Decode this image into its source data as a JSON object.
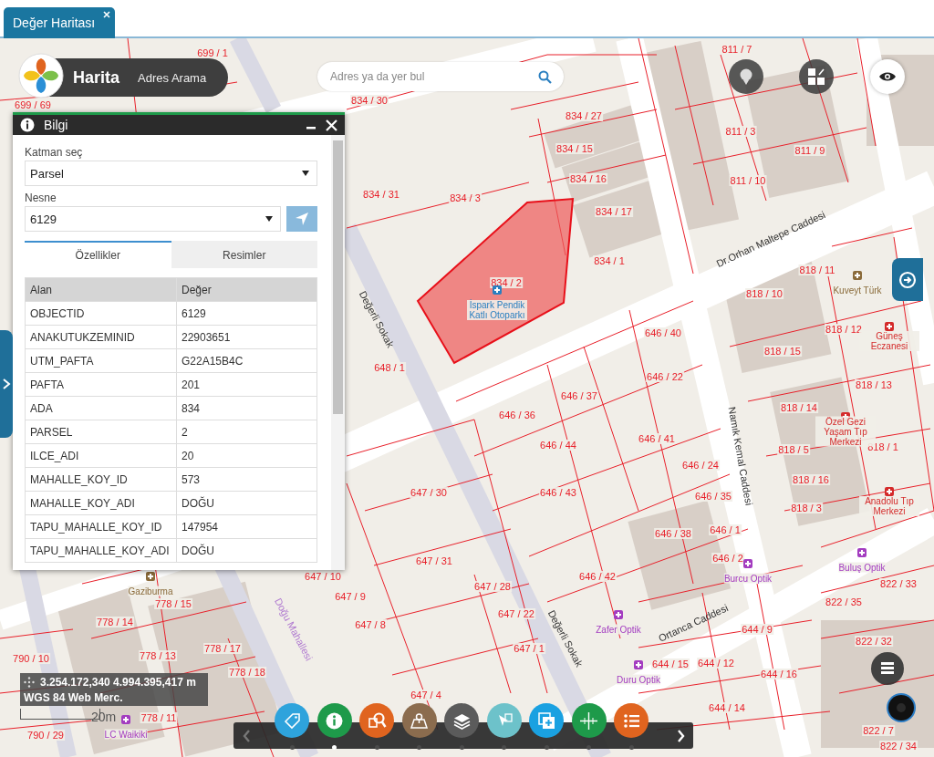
{
  "tabs": [
    {
      "label": "Değer Haritası",
      "selected": true
    }
  ],
  "app_bar": {
    "title": "Harita",
    "link": "Adres Arama"
  },
  "search": {
    "placeholder": "Adres ya da yer bul"
  },
  "info_panel": {
    "title": "Bilgi",
    "layer_label": "Katman seç",
    "layer_value": "Parsel",
    "object_label": "Nesne",
    "object_value": "6129",
    "tabs": [
      {
        "label": "Özellikler",
        "selected": true
      },
      {
        "label": "Resimler",
        "selected": false
      }
    ],
    "columns": [
      "Alan",
      "Değer"
    ],
    "rows": [
      [
        "OBJECTID",
        "6129"
      ],
      [
        "ANAKUTUKZEMINID",
        "22903651"
      ],
      [
        "UTM_PAFTA",
        "G22A15B4C"
      ],
      [
        "PAFTA",
        "201"
      ],
      [
        "ADA",
        "834"
      ],
      [
        "PARSEL",
        "2"
      ],
      [
        "ILCE_ADI",
        "20"
      ],
      [
        "MAHALLE_KOY_ID",
        "573"
      ],
      [
        "MAHALLE_KOY_ADI",
        "DOĞU"
      ],
      [
        "TAPU_MAHALLE_KOY_ID",
        "147954"
      ],
      [
        "TAPU_MAHALLE_KOY_ADI",
        "DOĞU"
      ]
    ]
  },
  "coordinates": {
    "position": "3.254.172,340 4.994.395,417 m",
    "projection": "WGS 84 Web Merc."
  },
  "scale": "20m",
  "toolbar": {
    "buttons": [
      {
        "kind": "tag",
        "color": "#2ea3dc",
        "selected": false
      },
      {
        "kind": "info",
        "color": "#1e9a4a",
        "selected": true
      },
      {
        "kind": "search",
        "color": "#e0641f",
        "selected": false
      },
      {
        "kind": "map",
        "color": "#8b6c4e",
        "selected": false
      },
      {
        "kind": "layers",
        "color": "#5b5b5b",
        "selected": false
      },
      {
        "kind": "pointer",
        "color": "#6dc2ca",
        "selected": false
      },
      {
        "kind": "add",
        "color": "#1aa1e1",
        "selected": false
      },
      {
        "kind": "crosshair",
        "color": "#1e9a4a",
        "selected": false
      },
      {
        "kind": "list",
        "color": "#e0641f",
        "selected": false
      }
    ]
  },
  "map": {
    "parcel_labels": [
      "699 / 1",
      "699 / 69",
      "834 / 30",
      "834 / 27",
      "834 / 15",
      "834 / 16",
      "834 / 31",
      "834 / 3",
      "834 / 17",
      "834 / 1",
      "834 / 2",
      "811 / 7",
      "811 / 3",
      "811 / 9",
      "811 / 10",
      "818 / 11",
      "818 / 10",
      "818 / 12",
      "818 / 15",
      "818 / 13",
      "818 / 14",
      "818 / 5",
      "818 / 1",
      "818 / 16",
      "818 / 3",
      "648 / 1",
      "646 / 40",
      "646 / 22",
      "646 / 37",
      "646 / 36",
      "646 / 41",
      "646 / 44",
      "646 / 24",
      "646 / 43",
      "646 / 35",
      "646 / 1",
      "646 / 38",
      "646 / 2",
      "646 / 42",
      "647 / 30",
      "647 / 31",
      "647 / 10",
      "647 / 28",
      "647 / 9",
      "647 / 22",
      "647 / 8",
      "647 / 1",
      "647 / 4",
      "644 / 9",
      "644 / 15",
      "644 / 12",
      "644 / 16",
      "644 / 14",
      "822 / 33",
      "822 / 35",
      "822 / 32",
      "822 / 7",
      "822 / 34",
      "778 / 15",
      "778 / 14",
      "778 / 17",
      "778 / 13",
      "778 / 18",
      "778 / 11",
      "790 / 10",
      "790 / 29"
    ],
    "street_labels": [
      "Dr.Orhan Maltepe Caddesi",
      "Değerli Sokak",
      "Değerli Sokak",
      "Namık Kemal Caddesi",
      "Ortanca Caddesi",
      "Doğu Mahallesi"
    ],
    "poi_labels": [
      {
        "text": "İspark Pendik Katlı Otoparkı",
        "color": "#2a7fc0"
      },
      {
        "text": "Kuveyt Türk",
        "color": "#8a6a3a"
      },
      {
        "text": "Güneş Eczanesi",
        "color": "#d42a2a"
      },
      {
        "text": "Özel Gezi Yaşam Tıp Merkezi",
        "color": "#d42a2a"
      },
      {
        "text": "Anadolu Tıp Merkezi",
        "color": "#d42a2a"
      },
      {
        "text": "Burcu Optik",
        "color": "#a33cc0"
      },
      {
        "text": "Zafer Optik",
        "color": "#a33cc0"
      },
      {
        "text": "Duru Optik",
        "color": "#a33cc0"
      },
      {
        "text": "Buluş Optik",
        "color": "#a33cc0"
      },
      {
        "text": "Gaziburma",
        "color": "#8a6a3a"
      },
      {
        "text": "LC Waikiki",
        "color": "#a33cc0"
      }
    ]
  }
}
